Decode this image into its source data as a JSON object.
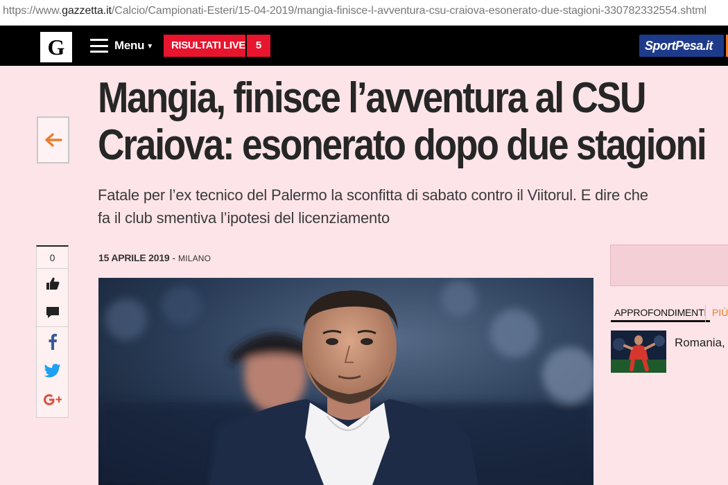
{
  "browser": {
    "url_prefix": "https://www.",
    "url_host": "gazzetta.it",
    "url_path": "/Calcio/Campionati-Esteri/15-04-2019/mangia-finisce-l-avventura-csu-craiova-esonerato-due-stagioni-330782332554.shtml"
  },
  "nav": {
    "logo_text": "G",
    "menu_label": "Menu",
    "menu_caret": "▾",
    "live_label": "RISULTATI LIVE",
    "live_count": "5",
    "sponsor_label": "SportPesa.it"
  },
  "article": {
    "headline_line1": "Mangia, finisce l’avventura al CSU",
    "headline_line2": "Craiova: esonerato dopo due stagioni",
    "subhead_line1": "Fatale per l’ex tecnico del Palermo la sconfitta di sabato contro il Viitorul. E dire che",
    "subhead_line2": "fa il club smentiva l’ipotesi del licenziamento",
    "date": "15 APRILE 2019",
    "separator": " - ",
    "city": "MILANO"
  },
  "share": {
    "count": "0"
  },
  "sidebar": {
    "tab_active": "APPROFONDIMENTI",
    "tab_more": "PIÙ",
    "related_title": "Romania,"
  },
  "colors": {
    "background": "#fde4e8",
    "nav_bar": "#000000",
    "live_red": "#e8152e",
    "accent_orange": "#e87d2a",
    "facebook_blue": "#3b5998",
    "twitter_blue": "#1da1f2",
    "gplus_red": "#dd4b39"
  },
  "icons": [
    "hamburger-icon",
    "back-arrow-icon",
    "like-icon",
    "comment-icon",
    "facebook-icon",
    "twitter-icon",
    "google-plus-icon"
  ]
}
